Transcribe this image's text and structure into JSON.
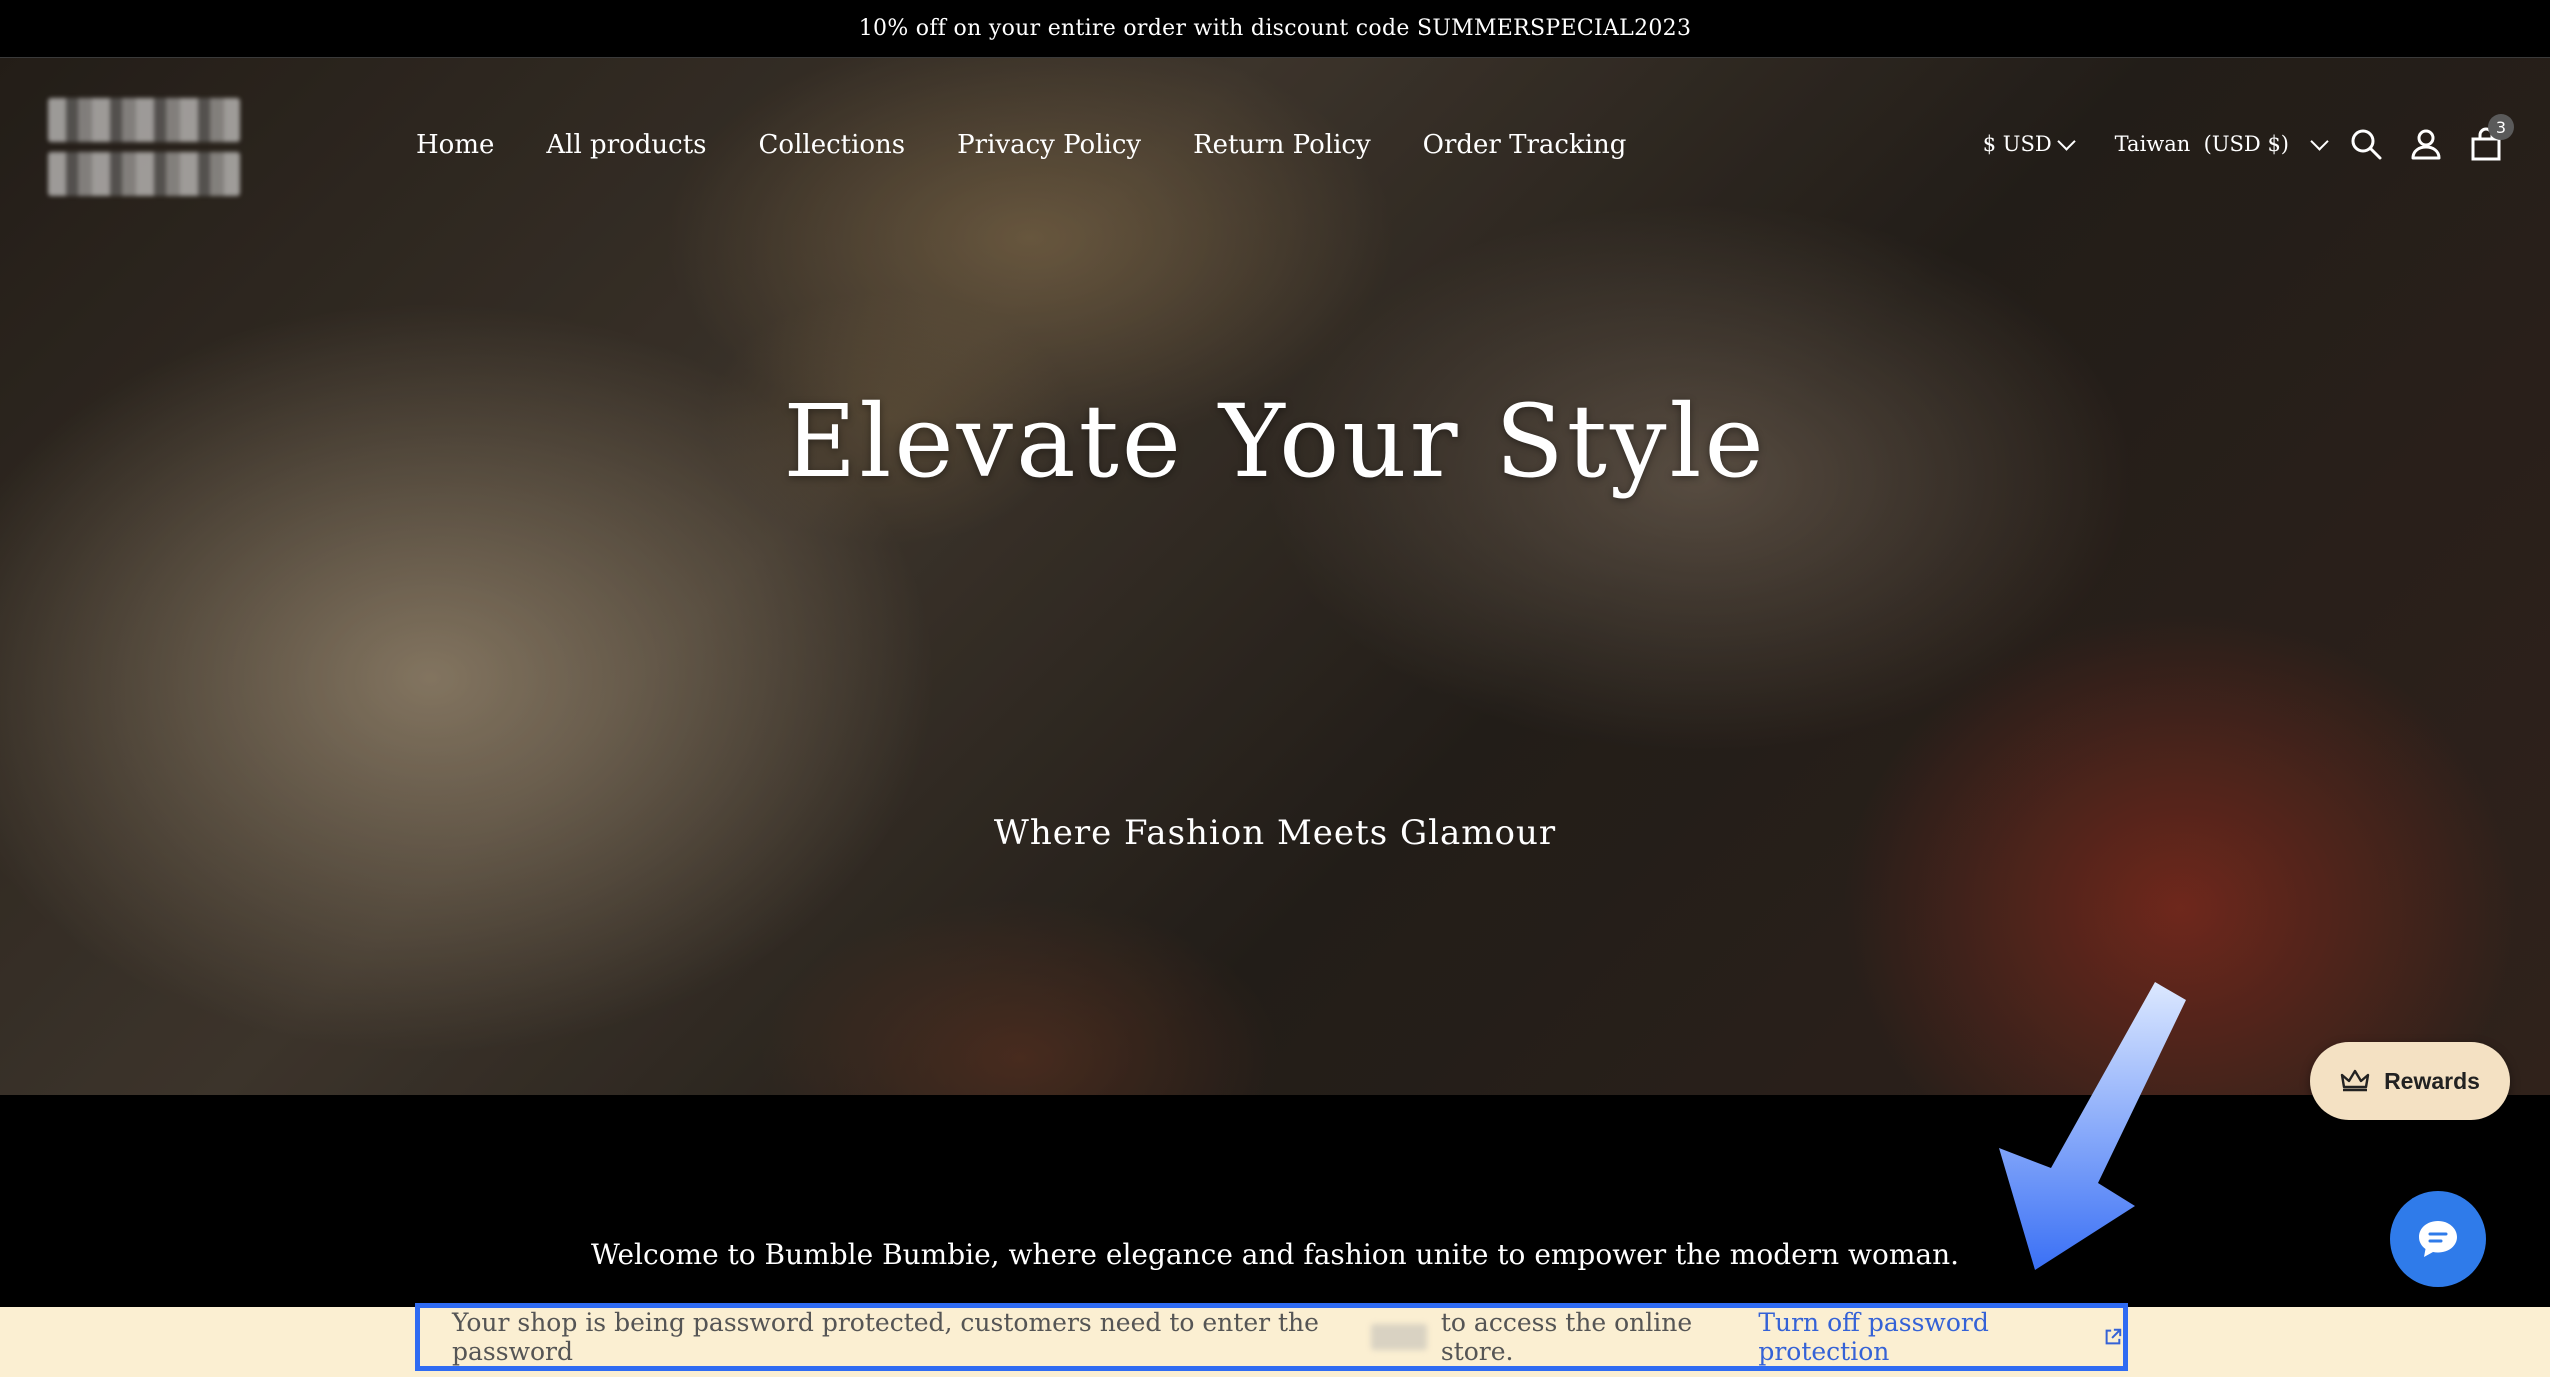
{
  "announcement": "10% off on your entire order with discount code SUMMERSPECIAL2023",
  "logo": {
    "lines": [
      "Bumble",
      "Bumbie"
    ]
  },
  "nav": {
    "items": [
      "Home",
      "All products",
      "Collections",
      "Privacy Policy",
      "Return Policy",
      "Order Tracking"
    ]
  },
  "header": {
    "currency": "$ USD",
    "country": "Taiwan  (USD $)",
    "cart_count": "3",
    "icons": [
      "search-icon",
      "account-icon",
      "cart-icon"
    ]
  },
  "hero": {
    "title": "Elevate Your Style",
    "subtitle": "Where Fashion Meets Glamour"
  },
  "welcome": "Welcome to Bumble Bumbie, where elegance and fashion unite to empower the modern woman.",
  "rewards": {
    "label": "Rewards",
    "icon": "crown-icon"
  },
  "chat": {
    "icon": "chat-bubble-icon",
    "color": "#2f7bea"
  },
  "password_notice": {
    "text_before": "Your shop is being password protected, customers need to enter the password",
    "text_after": "to access the online store.",
    "link": "Turn off password protection",
    "link_icon": "external-link-icon",
    "highlight_color": "#2f6bf2",
    "background": "#fbefd2"
  }
}
